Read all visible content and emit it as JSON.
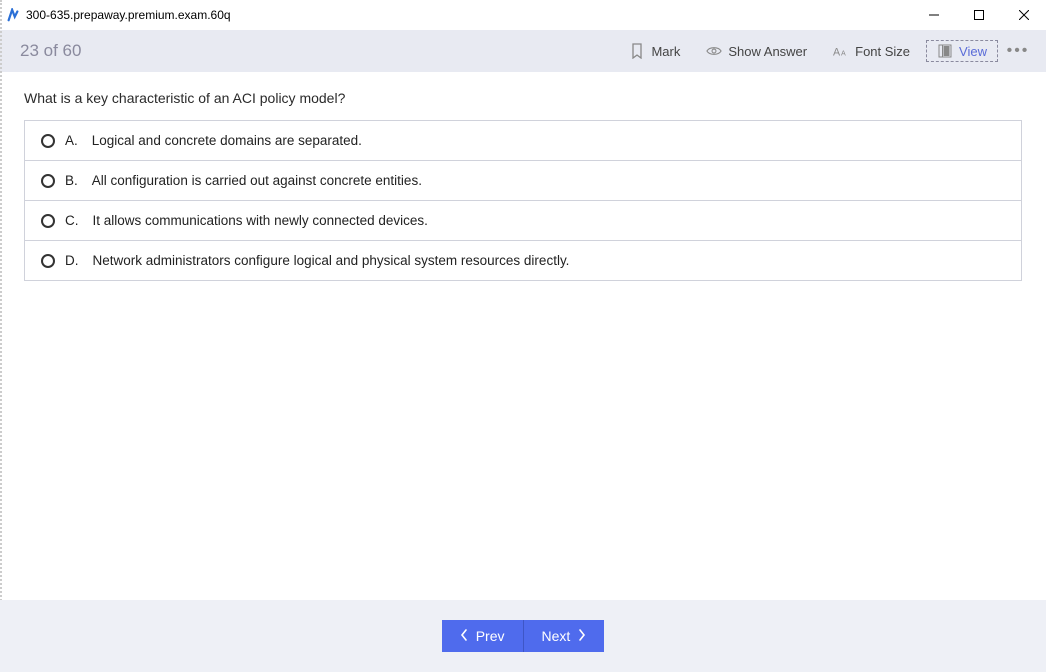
{
  "window": {
    "title": "300-635.prepaway.premium.exam.60q"
  },
  "toolbar": {
    "progress": "23 of 60",
    "mark": "Mark",
    "show_answer": "Show Answer",
    "font_size": "Font Size",
    "view": "View"
  },
  "question": {
    "text": "What is a key characteristic of an ACI policy model?",
    "options": [
      {
        "letter": "A.",
        "text": "Logical and concrete domains are separated."
      },
      {
        "letter": "B.",
        "text": "All configuration is carried out against concrete entities."
      },
      {
        "letter": "C.",
        "text": "It allows communications with newly connected devices."
      },
      {
        "letter": "D.",
        "text": "Network administrators configure logical and physical system resources directly."
      }
    ]
  },
  "nav": {
    "prev": "Prev",
    "next": "Next"
  }
}
